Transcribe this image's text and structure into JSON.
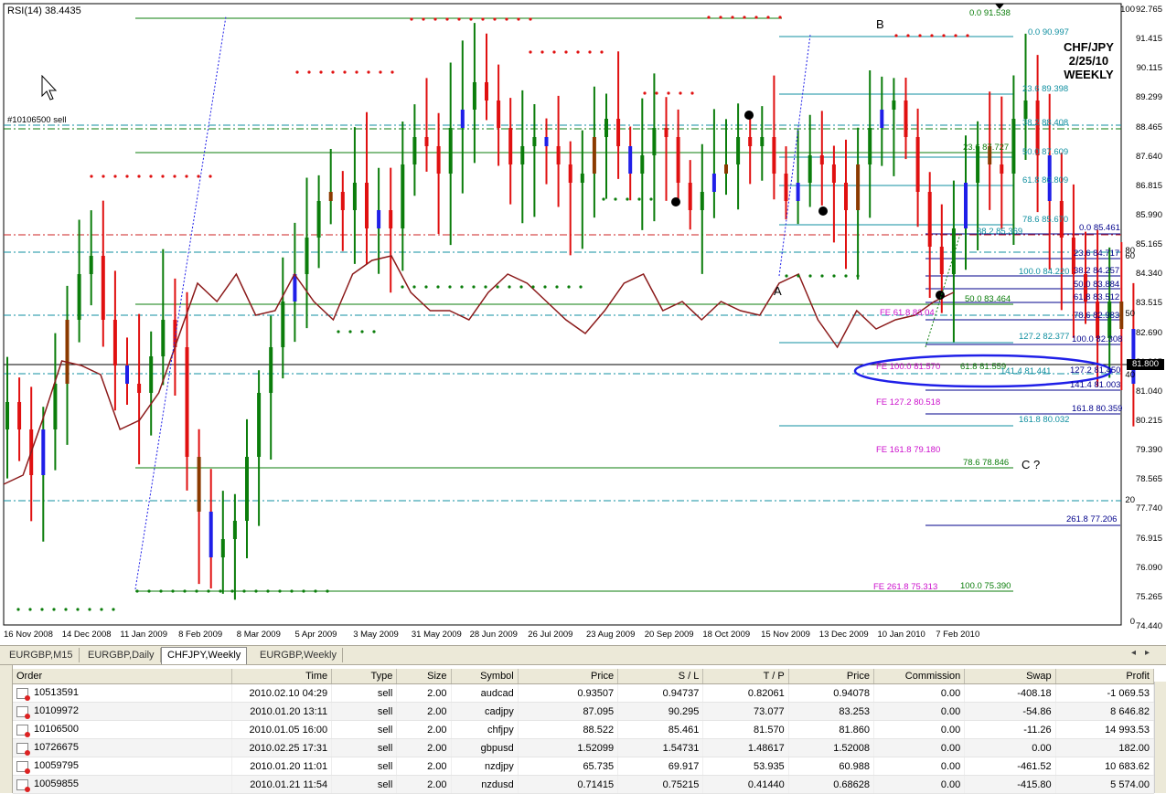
{
  "indicator": {
    "label": "RSI(14) 38.4435"
  },
  "trade_label": "#10106500 sell",
  "pair_title": {
    "line1": "CHF/JPY",
    "line2": "2/25/10",
    "line3": "WEEKLY"
  },
  "points": {
    "a": "A",
    "b": "B",
    "c": "C ?"
  },
  "current_price": "81.800",
  "price_axis": [
    "92.765",
    "91.415",
    "90.115",
    "89.299",
    "88.465",
    "87.640",
    "86.815",
    "85.990",
    "85.165",
    "84.340",
    "83.515",
    "82.690",
    "81.865",
    "81.040",
    "80.215",
    "79.390",
    "78.565",
    "77.740",
    "76.915",
    "76.090",
    "75.265",
    "74.440"
  ],
  "rsi_axis": [
    "100",
    "80",
    "60",
    "50",
    "40",
    "20",
    "0"
  ],
  "dates": [
    "16 Nov 2008",
    "14 Dec 2008",
    "11 Jan 2009",
    "8 Feb 2009",
    "8 Mar 2009",
    "5 Apr 2009",
    "3 May 2009",
    "31 May 2009",
    "28 Jun 2009",
    "26 Jul 2009",
    "23 Aug 2009",
    "20 Sep 2009",
    "18 Oct 2009",
    "15 Nov 2009",
    "13 Dec 2009",
    "10 Jan 2010",
    "7 Feb 2010"
  ],
  "fib_levels": [
    {
      "t": "0.0  91.538",
      "c": "green"
    },
    {
      "t": "0.0  90.997",
      "c": "teal"
    },
    {
      "t": "23.6  89.398",
      "c": "teal"
    },
    {
      "t": "38.2  88.408",
      "c": "teal"
    },
    {
      "t": "23.6  87.727",
      "c": "green"
    },
    {
      "t": "50.0  87.609",
      "c": "teal"
    },
    {
      "t": "61.8  86.809",
      "c": "teal"
    },
    {
      "t": "78.6  85.670",
      "c": "teal"
    },
    {
      "t": "38.2  85.369",
      "c": "teal"
    },
    {
      "t": "0.0  85.461",
      "c": "blue"
    },
    {
      "t": "23.6  84.717",
      "c": "blue"
    },
    {
      "t": "100.0  84.220",
      "c": "teal"
    },
    {
      "t": "38.2  84.257",
      "c": "blue"
    },
    {
      "t": "50.0  83.884",
      "c": "blue"
    },
    {
      "t": "61.8  83.512",
      "c": "blue"
    },
    {
      "t": "50.0  83.464",
      "c": "green"
    },
    {
      "t": "FE 61.8  83.04",
      "c": "magenta"
    },
    {
      "t": "78.6  82.983",
      "c": "blue"
    },
    {
      "t": "127.2  82.377",
      "c": "teal"
    },
    {
      "t": "100.0  82.308",
      "c": "blue"
    },
    {
      "t": "FE 100.0  81.570",
      "c": "magenta"
    },
    {
      "t": "61.8  81.559",
      "c": "green"
    },
    {
      "t": "141.4  81.441",
      "c": "teal"
    },
    {
      "t": "127.2  81.450",
      "c": "blue"
    },
    {
      "t": "141.4  81.003",
      "c": "blue"
    },
    {
      "t": "FE 127.2  80.518",
      "c": "magenta"
    },
    {
      "t": "161.8  80.359",
      "c": "blue"
    },
    {
      "t": "161.8  80.032",
      "c": "teal"
    },
    {
      "t": "FE 161.8  79.180",
      "c": "magenta"
    },
    {
      "t": "78.6  78.846",
      "c": "green"
    },
    {
      "t": "261.8  77.206",
      "c": "blue"
    },
    {
      "t": "FE 261.8  75.313",
      "c": "magenta"
    },
    {
      "t": "100.0  75.390",
      "c": "green"
    }
  ],
  "tabs": [
    "EURGBP,M15",
    "EURGBP,Daily",
    "CHFJPY,Weekly",
    "EURGBP,Weekly"
  ],
  "active_tab": "CHFJPY,Weekly",
  "terminal": {
    "side_label": "minal",
    "columns": [
      "Order",
      "Time",
      "Type",
      "Size",
      "Symbol",
      "Price",
      "S / L",
      "T / P",
      "Price",
      "Commission",
      "Swap",
      "Profit"
    ],
    "rows": [
      [
        "10513591",
        "2010.02.10 04:29",
        "sell",
        "2.00",
        "audcad",
        "0.93507",
        "0.94737",
        "0.82061",
        "0.94078",
        "0.00",
        "-408.18",
        "-1 069.53"
      ],
      [
        "10109972",
        "2010.01.20 13:11",
        "sell",
        "2.00",
        "cadjpy",
        "87.095",
        "90.295",
        "73.077",
        "83.253",
        "0.00",
        "-54.86",
        "8 646.82"
      ],
      [
        "10106500",
        "2010.01.05 16:00",
        "sell",
        "2.00",
        "chfjpy",
        "88.522",
        "85.461",
        "81.570",
        "81.860",
        "0.00",
        "-11.26",
        "14 993.53"
      ],
      [
        "10726675",
        "2010.02.25 17:31",
        "sell",
        "2.00",
        "gbpusd",
        "1.52099",
        "1.54731",
        "1.48617",
        "1.52008",
        "0.00",
        "0.00",
        "182.00"
      ],
      [
        "10059795",
        "2010.01.20 11:01",
        "sell",
        "2.00",
        "nzdjpy",
        "65.735",
        "69.917",
        "53.935",
        "60.988",
        "0.00",
        "-461.52",
        "10 683.62"
      ],
      [
        "10059855",
        "2010.01.21 11:54",
        "sell",
        "2.00",
        "nzdusd",
        "0.71415",
        "0.75215",
        "0.41440",
        "0.68628",
        "0.00",
        "-415.80",
        "5 574.00"
      ]
    ]
  }
}
